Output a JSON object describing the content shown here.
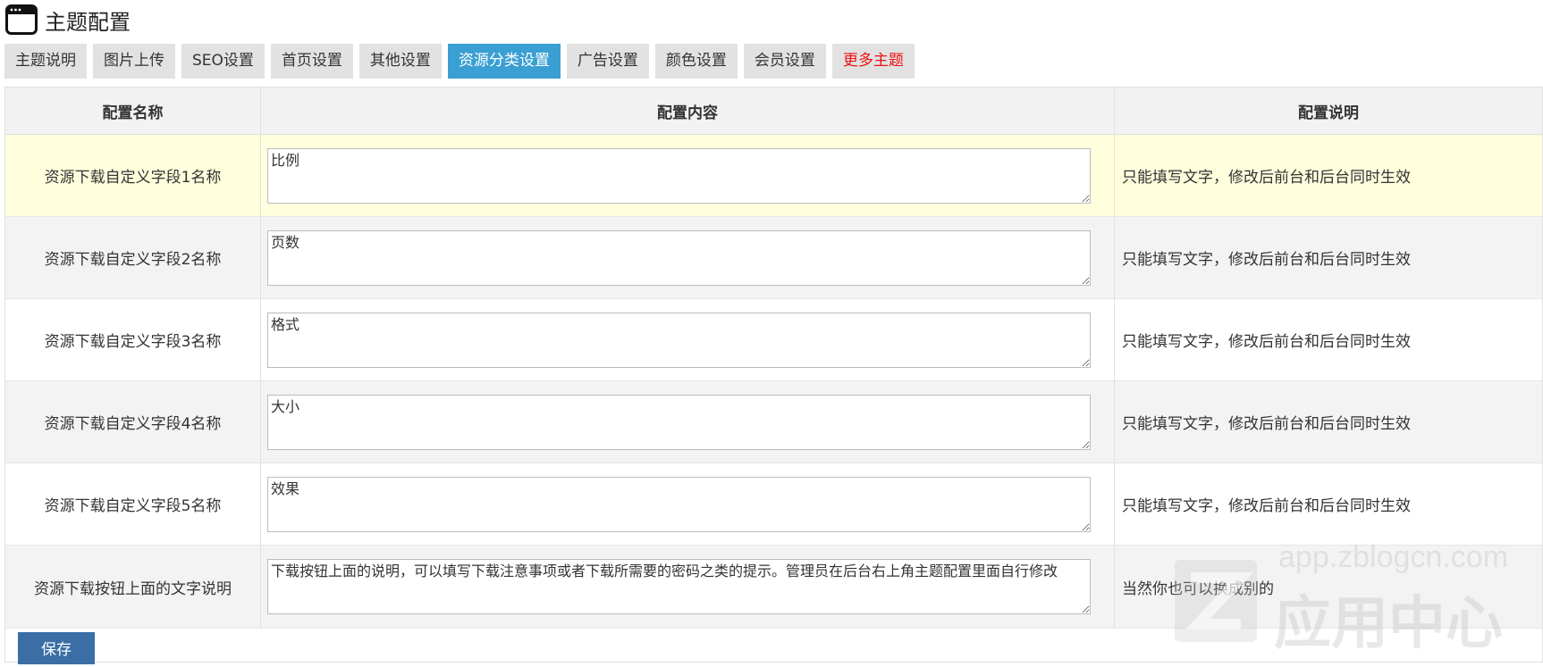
{
  "header": {
    "title": "主题配置",
    "icon": "window-icon"
  },
  "tabs": [
    {
      "label": "主题说明",
      "active": false
    },
    {
      "label": "图片上传",
      "active": false
    },
    {
      "label": "SEO设置",
      "active": false
    },
    {
      "label": "首页设置",
      "active": false
    },
    {
      "label": "其他设置",
      "active": false
    },
    {
      "label": "资源分类设置",
      "active": true
    },
    {
      "label": "广告设置",
      "active": false
    },
    {
      "label": "颜色设置",
      "active": false
    },
    {
      "label": "会员设置",
      "active": false
    },
    {
      "label": "更多主题",
      "active": false,
      "color": "#ee1111"
    }
  ],
  "table": {
    "headers": [
      "配置名称",
      "配置内容",
      "配置说明"
    ],
    "rows": [
      {
        "name": "资源下载自定义字段1名称",
        "value": "比例",
        "desc": "只能填写文字，修改后前台和后台同时生效"
      },
      {
        "name": "资源下载自定义字段2名称",
        "value": "页数",
        "desc": "只能填写文字，修改后前台和后台同时生效"
      },
      {
        "name": "资源下载自定义字段3名称",
        "value": "格式",
        "desc": "只能填写文字，修改后前台和后台同时生效"
      },
      {
        "name": "资源下载自定义字段4名称",
        "value": "大小",
        "desc": "只能填写文字，修改后前台和后台同时生效"
      },
      {
        "name": "资源下载自定义字段5名称",
        "value": "效果",
        "desc": "只能填写文字，修改后前台和后台同时生效"
      },
      {
        "name": "资源下载按钮上面的文字说明",
        "value": "下载按钮上面的说明，可以填写下载注意事项或者下载所需要的密码之类的提示。管理员在后台右上角主题配置里面自行修改",
        "desc": "当然你也可以换成别的"
      }
    ]
  },
  "footer": {
    "save_label": "保存"
  },
  "watermark": {
    "url": "app.zblogcn.com",
    "name": "应用中心"
  },
  "colors": {
    "active_tab": "#3a9fd2",
    "save_button": "#3a6ea5",
    "highlight_row": "#ffffdd",
    "more_themes": "#ee1111"
  }
}
